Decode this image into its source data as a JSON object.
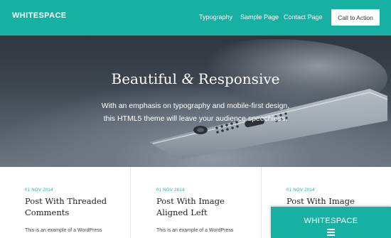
{
  "header": {
    "logo": "WHITESPACE",
    "nav": [
      {
        "label": "Typography"
      },
      {
        "label": "Sample Page"
      },
      {
        "label": "Contact Page"
      }
    ],
    "cta_label": "Call to Action",
    "background_color": "#17b1a3"
  },
  "hero": {
    "title_part1": "Beautiful ",
    "title_amp": "&",
    "title_part2": " Responsive",
    "subtitle_line1": "With an emphasis on typography and mobile-first design,",
    "subtitle_line2": "this HTML5 theme will leave your audience speechless."
  },
  "posts": [
    {
      "date": "01 NOV 2014",
      "title": "Post With Threaded Comments",
      "excerpt": "This is an example of a WordPress"
    },
    {
      "date": "01 NOV 2014",
      "title": "Post With Image Aligned Left",
      "excerpt": "This is an example of a WordPress"
    },
    {
      "date": "01 NOV 2014",
      "title": "Post With Image"
    }
  ],
  "mobile_preview": {
    "logo": "WHITESPACE",
    "menu_icon": "hamburger-menu-icon"
  }
}
